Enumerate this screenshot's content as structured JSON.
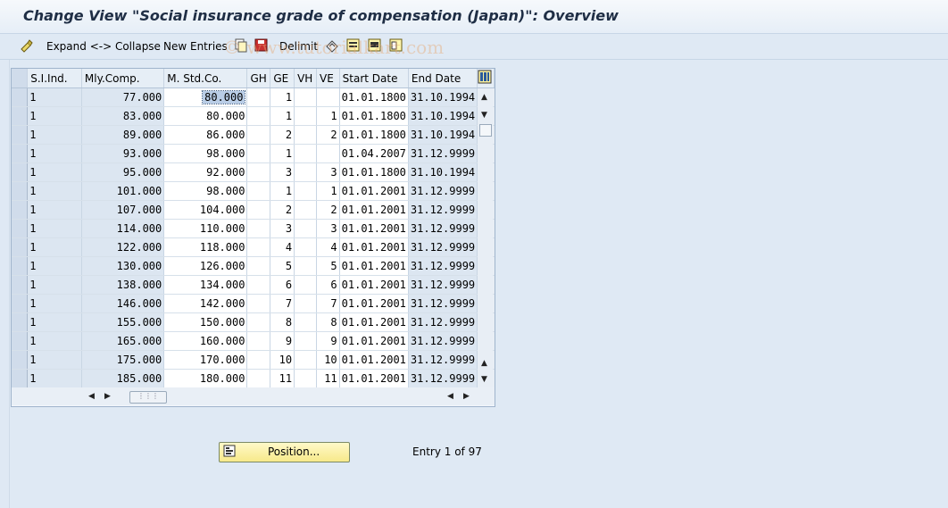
{
  "window": {
    "title": "Change View \"Social insurance grade of compensation (Japan)\": Overview"
  },
  "toolbar": {
    "expand_collapse_label": "Expand <-> Collapse",
    "new_entries_label": "New Entries",
    "delimit_label": "Delimit",
    "icons": [
      "glasses-icon",
      "copy-icon",
      "save-icon",
      "delete-icon",
      "undo-icon",
      "select-all-icon",
      "select-block-icon",
      "deselect-icon"
    ]
  },
  "watermark": {
    "text": "© www.tutorialkart.com"
  },
  "table": {
    "columns": [
      "S.I.Ind.",
      "Mly.Comp.",
      "M. Std.Co.",
      "GH",
      "GE",
      "VH",
      "VE",
      "Start Date",
      "End Date"
    ],
    "rows": [
      {
        "si": "1",
        "mly": "77.000",
        "mstd": "80.000",
        "gh": "",
        "ge": "1",
        "vh": "",
        "ve": "",
        "start": "01.01.1800",
        "end": "31.10.1994"
      },
      {
        "si": "1",
        "mly": "83.000",
        "mstd": "80.000",
        "gh": "",
        "ge": "1",
        "vh": "",
        "ve": "1",
        "start": "01.01.1800",
        "end": "31.10.1994"
      },
      {
        "si": "1",
        "mly": "89.000",
        "mstd": "86.000",
        "gh": "",
        "ge": "2",
        "vh": "",
        "ve": "2",
        "start": "01.01.1800",
        "end": "31.10.1994"
      },
      {
        "si": "1",
        "mly": "93.000",
        "mstd": "98.000",
        "gh": "",
        "ge": "1",
        "vh": "",
        "ve": "",
        "start": "01.04.2007",
        "end": "31.12.9999"
      },
      {
        "si": "1",
        "mly": "95.000",
        "mstd": "92.000",
        "gh": "",
        "ge": "3",
        "vh": "",
        "ve": "3",
        "start": "01.01.1800",
        "end": "31.10.1994"
      },
      {
        "si": "1",
        "mly": "101.000",
        "mstd": "98.000",
        "gh": "",
        "ge": "1",
        "vh": "",
        "ve": "1",
        "start": "01.01.2001",
        "end": "31.12.9999"
      },
      {
        "si": "1",
        "mly": "107.000",
        "mstd": "104.000",
        "gh": "",
        "ge": "2",
        "vh": "",
        "ve": "2",
        "start": "01.01.2001",
        "end": "31.12.9999"
      },
      {
        "si": "1",
        "mly": "114.000",
        "mstd": "110.000",
        "gh": "",
        "ge": "3",
        "vh": "",
        "ve": "3",
        "start": "01.01.2001",
        "end": "31.12.9999"
      },
      {
        "si": "1",
        "mly": "122.000",
        "mstd": "118.000",
        "gh": "",
        "ge": "4",
        "vh": "",
        "ve": "4",
        "start": "01.01.2001",
        "end": "31.12.9999"
      },
      {
        "si": "1",
        "mly": "130.000",
        "mstd": "126.000",
        "gh": "",
        "ge": "5",
        "vh": "",
        "ve": "5",
        "start": "01.01.2001",
        "end": "31.12.9999"
      },
      {
        "si": "1",
        "mly": "138.000",
        "mstd": "134.000",
        "gh": "",
        "ge": "6",
        "vh": "",
        "ve": "6",
        "start": "01.01.2001",
        "end": "31.12.9999"
      },
      {
        "si": "1",
        "mly": "146.000",
        "mstd": "142.000",
        "gh": "",
        "ge": "7",
        "vh": "",
        "ve": "7",
        "start": "01.01.2001",
        "end": "31.12.9999"
      },
      {
        "si": "1",
        "mly": "155.000",
        "mstd": "150.000",
        "gh": "",
        "ge": "8",
        "vh": "",
        "ve": "8",
        "start": "01.01.2001",
        "end": "31.12.9999"
      },
      {
        "si": "1",
        "mly": "165.000",
        "mstd": "160.000",
        "gh": "",
        "ge": "9",
        "vh": "",
        "ve": "9",
        "start": "01.01.2001",
        "end": "31.12.9999"
      },
      {
        "si": "1",
        "mly": "175.000",
        "mstd": "170.000",
        "gh": "",
        "ge": "10",
        "vh": "",
        "ve": "10",
        "start": "01.01.2001",
        "end": "31.12.9999"
      },
      {
        "si": "1",
        "mly": "185.000",
        "mstd": "180.000",
        "gh": "",
        "ge": "11",
        "vh": "",
        "ve": "11",
        "start": "01.01.2001",
        "end": "31.12.9999"
      }
    ]
  },
  "footer": {
    "position_button_label": "Position...",
    "entry_text": "Entry 1 of 97"
  },
  "colors": {
    "background": "#dfe9f4",
    "header": "#e6eef6",
    "button": "#f7e98a"
  }
}
